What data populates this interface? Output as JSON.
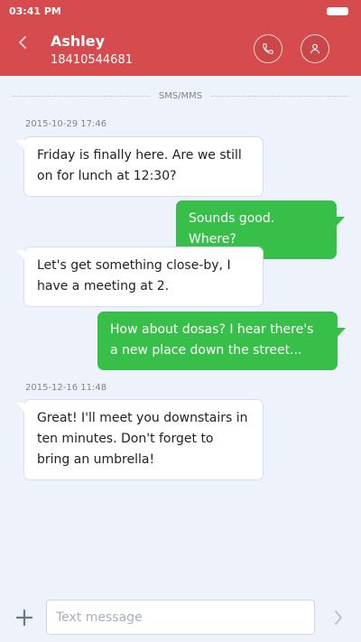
{
  "status_bar": {
    "time": "03:41 PM"
  },
  "header": {
    "contact_name": "Ashley",
    "contact_number": "18410544681"
  },
  "conversation": {
    "channel_label": "SMS/MMS",
    "timestamps": [
      "2015-10-29 17:46",
      "2015-12-16 11:48"
    ],
    "messages": [
      {
        "direction": "in",
        "text": "Friday is finally here. Are we still on for lunch at 12:30?"
      },
      {
        "direction": "out",
        "text": "Sounds good. Where?"
      },
      {
        "direction": "in",
        "text": "Let's get something close-by, I have a meeting at 2."
      },
      {
        "direction": "out",
        "text": "How about dosas? I hear there's a new place down the street..."
      },
      {
        "direction": "in",
        "text": "Great! I'll meet you downstairs in ten minutes. Don't forget to bring an umbrella!"
      }
    ]
  },
  "composer": {
    "placeholder": "Text message"
  },
  "colors": {
    "header": "#d64c4e",
    "outgoing_bubble": "#38bf4a",
    "incoming_bubble": "#ffffff",
    "background": "#eef3fb"
  },
  "icons": {
    "back": "back-chevron-icon",
    "call": "phone-icon",
    "contact": "person-icon",
    "attach": "plus-icon",
    "send": "send-chevron-icon"
  }
}
